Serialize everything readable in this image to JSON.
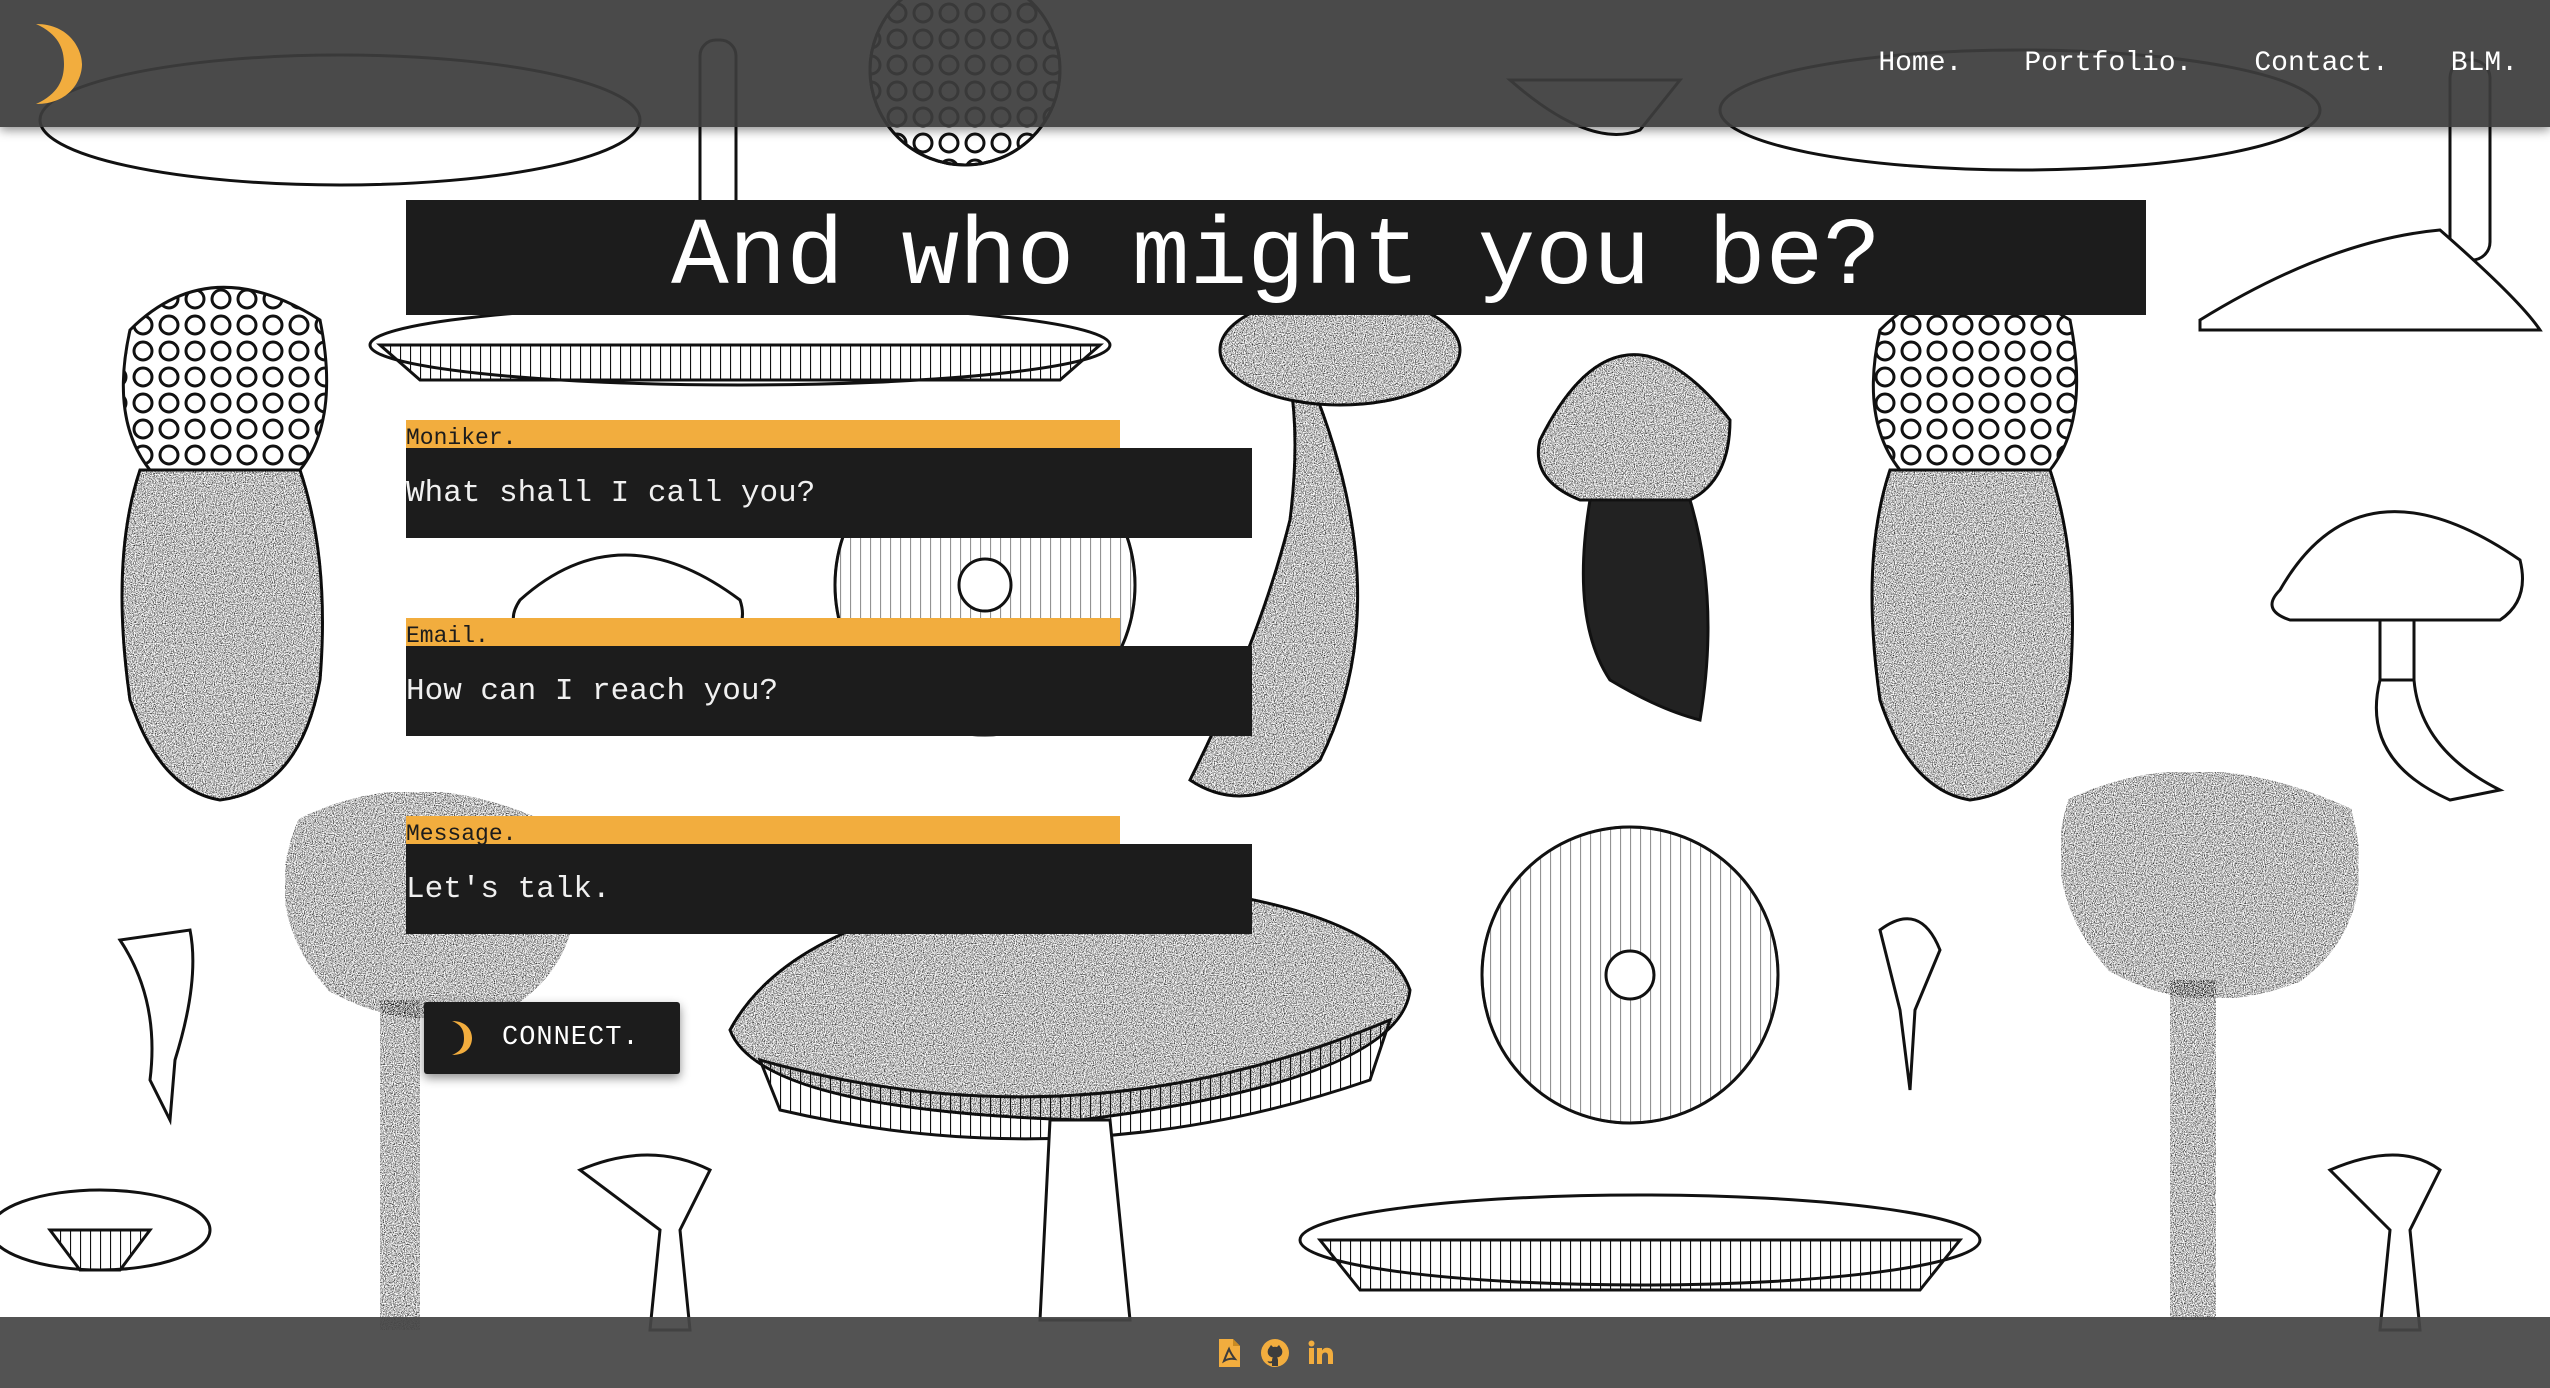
{
  "nav": {
    "logo_icon": "crescent-moon-icon",
    "links": [
      "Home.",
      "Portfolio.",
      "Contact.",
      "BLM."
    ]
  },
  "heading": "And who might you be?",
  "form": {
    "moniker": {
      "label": "Moniker.",
      "placeholder": "What shall I call you?"
    },
    "email": {
      "label": "Email.",
      "placeholder": "How can I reach you?"
    },
    "message": {
      "label": "Message.",
      "placeholder": "Let's talk."
    },
    "submit": {
      "label": "CONNECT.",
      "icon": "crescent-moon-icon"
    }
  },
  "footer": {
    "icons": [
      "pdf-file-icon",
      "github-icon",
      "linkedin-icon"
    ]
  },
  "colors": {
    "accent": "#f2ad3e",
    "dark_panel": "#1c1c1c",
    "nav_bg": "#3c3c3c",
    "text_light": "#ffffff"
  },
  "background": "mushroom-illustration-pattern"
}
